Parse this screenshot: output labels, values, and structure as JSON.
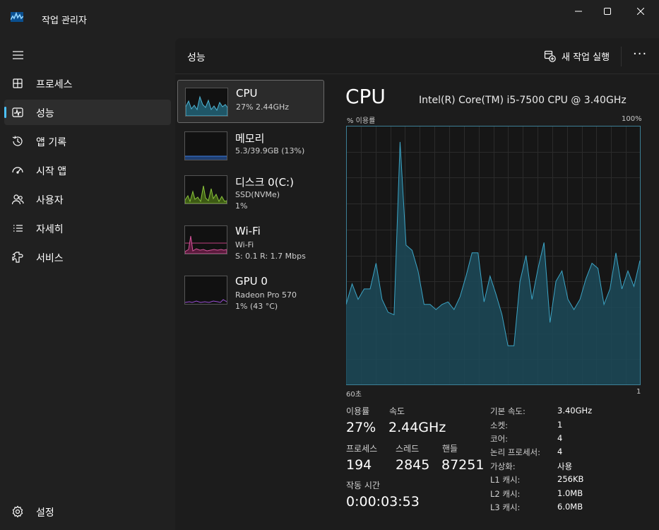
{
  "window": {
    "title": "작업 관리자",
    "controls": [
      "minimize-icon",
      "maximize-icon",
      "close-icon"
    ]
  },
  "nav": {
    "menu_icon": "hamburger-icon",
    "items": [
      {
        "label": "프로세스",
        "icon": "processes-icon",
        "selected": false
      },
      {
        "label": "성능",
        "icon": "performance-icon",
        "selected": true
      },
      {
        "label": "앱 기록",
        "icon": "history-icon",
        "selected": false
      },
      {
        "label": "시작 앱",
        "icon": "startup-icon",
        "selected": false
      },
      {
        "label": "사용자",
        "icon": "users-icon",
        "selected": false
      },
      {
        "label": "자세히",
        "icon": "details-icon",
        "selected": false
      },
      {
        "label": "서비스",
        "icon": "services-icon",
        "selected": false
      }
    ],
    "settings_label": "설정"
  },
  "header": {
    "title": "성능",
    "run_task_label": "새 작업 실행",
    "more_label": "···"
  },
  "perf_list": [
    {
      "name": "CPU",
      "sub1": "27% 2.44GHz",
      "sub2": "",
      "selected": true
    },
    {
      "name": "메모리",
      "sub1": "5.3/39.9GB (13%)",
      "sub2": "",
      "selected": false
    },
    {
      "name": "디스크 0(C:)",
      "sub1": "SSD(NVMe)",
      "sub2": "1%",
      "selected": false
    },
    {
      "name": "Wi-Fi",
      "sub1": "Wi-Fi",
      "sub2": "S: 0.1  R: 1.7 Mbps",
      "selected": false
    },
    {
      "name": "GPU 0",
      "sub1": "Radeon Pro 570",
      "sub2": "1% (43 °C)",
      "selected": false
    }
  ],
  "detail": {
    "title": "CPU",
    "model": "Intel(R) Core(TM) i5-7500 CPU @ 3.40GHz",
    "graph_ylabel": "% 이용률",
    "graph_ymax": "100%",
    "graph_xleft": "60초",
    "graph_xright": "1",
    "accent_color": "#3ca5c6",
    "utilization_history": [
      31,
      39,
      33,
      37,
      37,
      47,
      33,
      28,
      27,
      94,
      54,
      52,
      44,
      31,
      31,
      29,
      31,
      32,
      29,
      34,
      42,
      51,
      51,
      32,
      42,
      35,
      27,
      15,
      15,
      40,
      50,
      33,
      45,
      55,
      24,
      40,
      44,
      33,
      29,
      33,
      41,
      47,
      45,
      31,
      37,
      51,
      37,
      44,
      38,
      48
    ],
    "stats": {
      "utilization_label": "이용률",
      "utilization_value": "27%",
      "speed_label": "속도",
      "speed_value": "2.44GHz",
      "processes_label": "프로세스",
      "processes_value": "194",
      "threads_label": "스레드",
      "threads_value": "2845",
      "handles_label": "핸들",
      "handles_value": "87251",
      "uptime_label": "작동 시간",
      "uptime_value": "0:00:03:53"
    },
    "specs": [
      {
        "k": "기본 속도:",
        "v": "3.40GHz"
      },
      {
        "k": "소켓:",
        "v": "1"
      },
      {
        "k": "코어:",
        "v": "4"
      },
      {
        "k": "논리 프로세서:",
        "v": "4"
      },
      {
        "k": "가상화:",
        "v": "사용"
      },
      {
        "k": "L1 캐시:",
        "v": "256KB"
      },
      {
        "k": "L2 캐시:",
        "v": "1.0MB"
      },
      {
        "k": "L3 캐시:",
        "v": "6.0MB"
      }
    ]
  }
}
